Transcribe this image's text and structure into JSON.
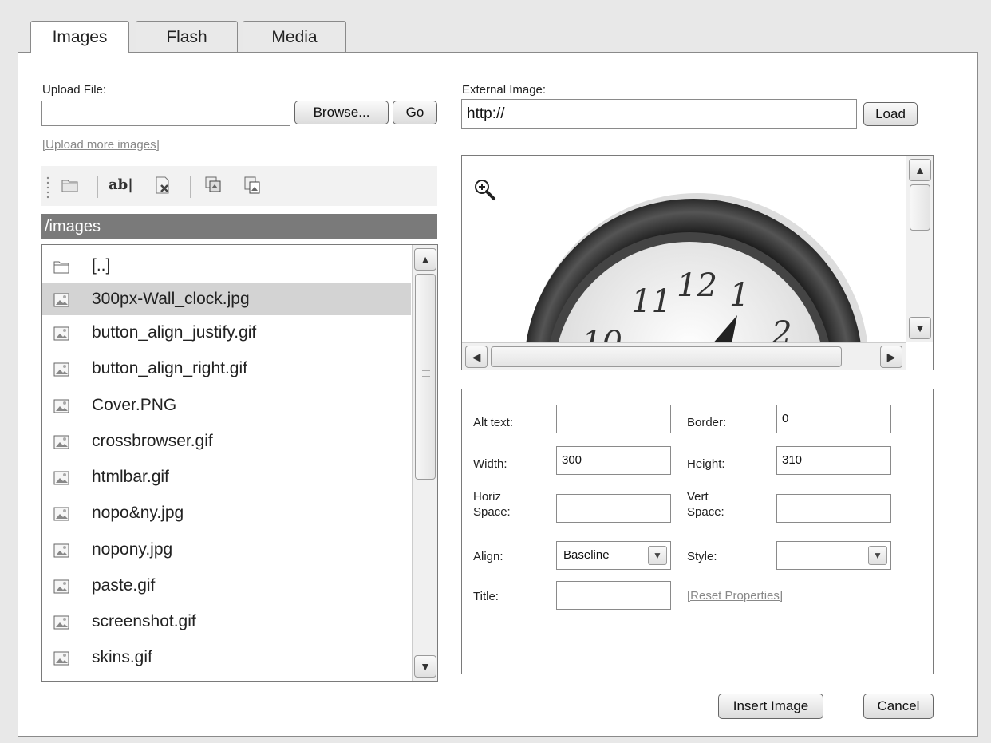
{
  "tabs": [
    {
      "label": "Images",
      "active": true
    },
    {
      "label": "Flash",
      "active": false
    },
    {
      "label": "Media",
      "active": false
    }
  ],
  "upload": {
    "label": "Upload File:",
    "value": "",
    "browse_label": "Browse...",
    "go_label": "Go",
    "more_link": "[Upload more images]"
  },
  "toolbar": {
    "icons": [
      "new-folder-icon",
      "rename-icon",
      "delete-icon",
      "copy-icon",
      "paste-icon"
    ]
  },
  "current_path": "/images",
  "files": [
    {
      "name": "[..]",
      "type": "folder",
      "selected": false
    },
    {
      "name": "300px-Wall_clock.jpg",
      "type": "image",
      "selected": true
    },
    {
      "name": "button_align_justify.gif",
      "type": "image",
      "selected": false
    },
    {
      "name": "button_align_right.gif",
      "type": "image",
      "selected": false
    },
    {
      "name": "Cover.PNG",
      "type": "image",
      "selected": false
    },
    {
      "name": "crossbrowser.gif",
      "type": "image",
      "selected": false
    },
    {
      "name": "htmlbar.gif",
      "type": "image",
      "selected": false
    },
    {
      "name": "nopo&ny.jpg",
      "type": "image",
      "selected": false
    },
    {
      "name": "nopony.jpg",
      "type": "image",
      "selected": false
    },
    {
      "name": "paste.gif",
      "type": "image",
      "selected": false
    },
    {
      "name": "screenshot.gif",
      "type": "image",
      "selected": false
    },
    {
      "name": "skins.gif",
      "type": "image",
      "selected": false
    }
  ],
  "external": {
    "label": "External Image:",
    "value": "http://",
    "load_label": "Load"
  },
  "preview": {
    "zoom_icon": "zoom-in-icon",
    "clock_numerals": [
      "11",
      "12",
      "1",
      "2",
      "10"
    ]
  },
  "properties": {
    "alt_label": "Alt text:",
    "alt_value": "",
    "border_label": "Border:",
    "border_value": "0",
    "width_label": "Width:",
    "width_value": "300",
    "height_label": "Height:",
    "height_value": "310",
    "hspace_label_1": "Horiz",
    "hspace_label_2": "Space:",
    "hspace_value": "",
    "vspace_label_1": "Vert",
    "vspace_label_2": "Space:",
    "vspace_value": "",
    "align_label": "Align:",
    "align_value": "Baseline",
    "style_label": "Style:",
    "style_value": "",
    "title_label": "Title:",
    "title_value": "",
    "reset_link": "[Reset Properties]"
  },
  "actions": {
    "insert_label": "Insert Image",
    "cancel_label": "Cancel"
  }
}
